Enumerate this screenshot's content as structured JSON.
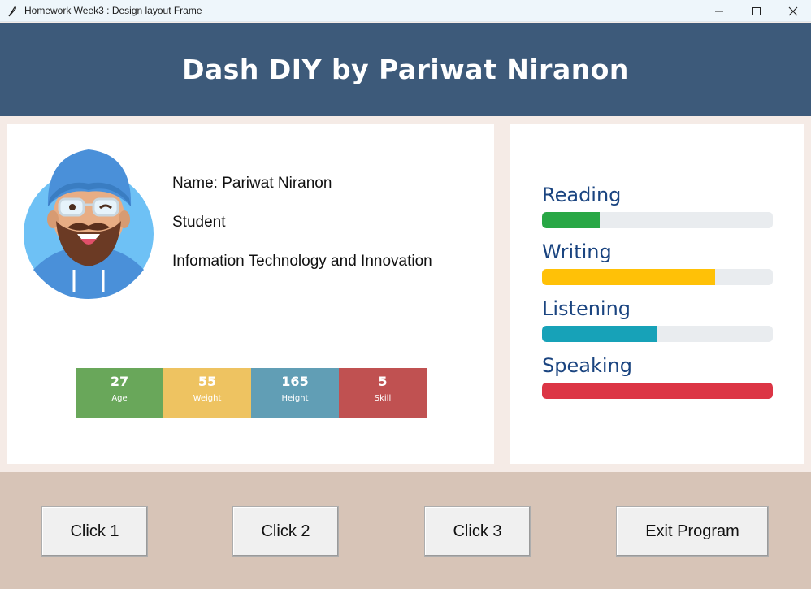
{
  "window": {
    "title": "Homework Week3 : Design layout Frame"
  },
  "header": {
    "title": "Dash DIY by Pariwat Niranon",
    "background": "#3d5a7a"
  },
  "profile": {
    "name": "Name: Pariwat Niranon",
    "role": "Student",
    "department": "Infomation Technology and Innovation",
    "avatar_icon": "avatar-man-turban-icon"
  },
  "stats": [
    {
      "value": "27",
      "label": "Age",
      "color": "#69a75a"
    },
    {
      "value": "55",
      "label": "Weight",
      "color": "#eec361"
    },
    {
      "value": "165",
      "label": "Height",
      "color": "#619eb5"
    },
    {
      "value": "5",
      "label": "Skill",
      "color": "#c05151"
    }
  ],
  "skills": [
    {
      "name": "Reading",
      "percent": 25,
      "color": "#28a745"
    },
    {
      "name": "Writing",
      "percent": 75,
      "color": "#ffc107"
    },
    {
      "name": "Listening",
      "percent": 50,
      "color": "#17a2b8"
    },
    {
      "name": "Speaking",
      "percent": 100,
      "color": "#dc3545"
    }
  ],
  "buttons": {
    "click1": "Click 1",
    "click2": "Click 2",
    "click3": "Click 3",
    "exit": "Exit Program"
  }
}
